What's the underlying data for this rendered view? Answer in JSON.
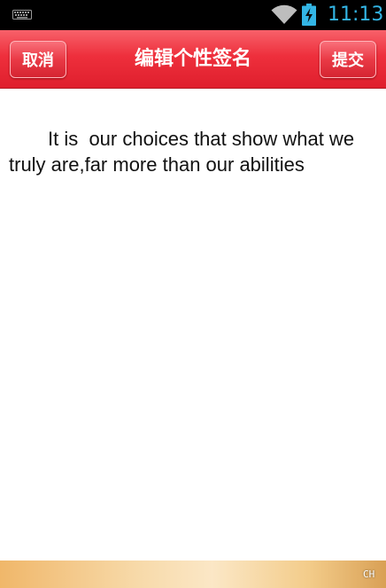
{
  "status_bar": {
    "time": "11:13",
    "icons": [
      "keyboard-icon",
      "wifi-icon",
      "battery-charging-icon"
    ]
  },
  "header": {
    "title": "编辑个性签名",
    "cancel_label": "取消",
    "submit_label": "提交"
  },
  "content": {
    "signature_text": "It is  our choices that show what we truly are,far more than our abilities"
  },
  "bottom_bar": {
    "ime_label": "CH"
  },
  "colors": {
    "header_red": "#ee2f3c",
    "clock_blue": "#33b5e5",
    "bottom_gold": "#f3cc8a"
  }
}
